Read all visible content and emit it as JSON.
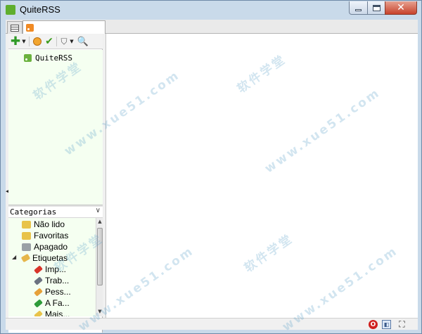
{
  "window": {
    "title": "QuiteRSS",
    "icon": "rss-app-icon",
    "buttons": {
      "minimize": "minimize-icon",
      "maximize": "maximize-icon",
      "close": "close-icon",
      "close_glyph": "✕"
    }
  },
  "tabs": [
    {
      "icon": "feeds-list-icon"
    },
    {
      "icon": "rss-icon"
    }
  ],
  "feeds_toolbar": {
    "add": {
      "glyph": "✚",
      "icon": "add-feed-icon"
    },
    "add_dropdown": {
      "glyph": "▼"
    },
    "update": {
      "icon": "update-feeds-icon"
    },
    "mark_read": {
      "glyph": "✔",
      "icon": "mark-read-icon"
    },
    "filter": {
      "glyph": "⛉",
      "icon": "filter-icon"
    },
    "filter_dropdown": {
      "glyph": "▼"
    },
    "search": {
      "glyph": "🔍",
      "icon": "search-icon"
    }
  },
  "feed_tree": {
    "items": [
      {
        "label": "QuiteRSS",
        "icon": "rss-feed-icon"
      }
    ]
  },
  "categories": {
    "title": "Categorias",
    "toggle_glyph": "∨",
    "items": [
      {
        "label": "Não lido",
        "icon": "unread-folder-icon",
        "color": "#e8c34a"
      },
      {
        "label": "Favoritas",
        "icon": "star-folder-icon",
        "color": "#e8c34a"
      },
      {
        "label": "Apagado",
        "icon": "trash-folder-icon",
        "color": "#9aa0a6"
      },
      {
        "label": "Etiquetas",
        "icon": "tag-icon",
        "color": "#e6b64a",
        "expander": "◢"
      },
      {
        "label": "Imp...",
        "icon": "tag-red-icon",
        "color": "#d8352a"
      },
      {
        "label": "Trab...",
        "icon": "tag-gray-icon",
        "color": "#6b7280"
      },
      {
        "label": "Pess...",
        "icon": "tag-orange-icon",
        "color": "#e6a13a"
      },
      {
        "label": "A Fa...",
        "icon": "tag-green-icon",
        "color": "#2e9b3a"
      },
      {
        "label": "Mais...",
        "icon": "tag-yellow-icon",
        "color": "#e8c34a"
      }
    ]
  },
  "scrollbar": {
    "up_glyph": "▲",
    "down_glyph": "▼"
  },
  "statusbar": {
    "opera": {
      "glyph": "O",
      "icon": "opera-icon"
    },
    "restore": {
      "glyph": "◧",
      "icon": "restore-window-icon"
    },
    "fullscreen": {
      "glyph": "⛶",
      "icon": "fullscreen-icon"
    }
  },
  "collapse_glyph": "◀",
  "watermark": {
    "text": "www.xue51.com",
    "text_cn": "软件学堂"
  }
}
